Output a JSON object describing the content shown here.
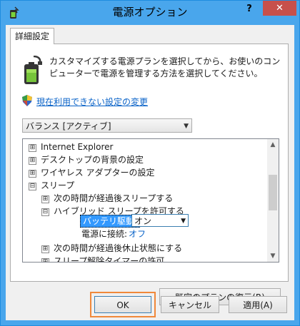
{
  "window": {
    "title": "電源オプション",
    "help_label": "?",
    "close_label": "✕"
  },
  "tab": {
    "label": "詳細設定"
  },
  "intro": {
    "text": "カスタマイズする電源プランを選択してから、お使いのコンピューターで電源を管理する方法を選択してください。"
  },
  "change_link": "現在利用できない設定の変更",
  "plan_select": {
    "value": "バランス [アクティブ]"
  },
  "tree": {
    "items": [
      {
        "toggle": "⊞",
        "label": "Internet Explorer"
      },
      {
        "toggle": "⊞",
        "label": "デスクトップの背景の設定"
      },
      {
        "toggle": "⊞",
        "label": "ワイヤレス アダプターの設定"
      },
      {
        "toggle": "⊟",
        "label": "スリープ"
      },
      {
        "toggle": "⊞",
        "label": "次の時間が経過後スリープする"
      },
      {
        "toggle": "⊟",
        "label": "ハイブリッド スリープを許可する"
      },
      {
        "toggle": "⊞",
        "label": "次の時間が経過後休止状態にする"
      },
      {
        "toggle": "⊞",
        "label": "スリープ解除タイマーの許可"
      }
    ],
    "battery_label": "バッテリ駆動:",
    "battery_value": "オン",
    "ac_label": "電源に接続:",
    "ac_value": "オフ"
  },
  "buttons": {
    "restore": "既定のプランの復元(R)",
    "ok": "OK",
    "cancel": "キャンセル",
    "apply": "適用(A)"
  },
  "colors": {
    "titlebar": "#49a6ec",
    "close": "#c7504b",
    "link": "#0a63c8",
    "highlight": "#f0883a",
    "selection": "#3399ff"
  }
}
